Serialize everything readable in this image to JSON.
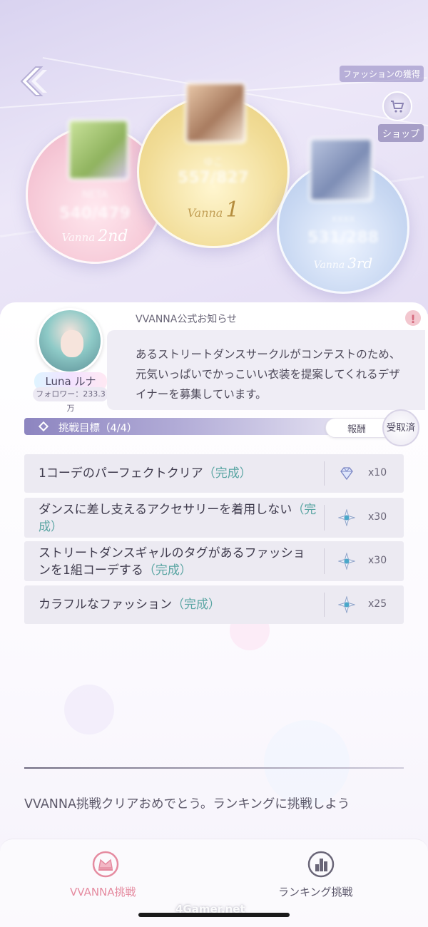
{
  "top": {
    "fashion_acquire_label": "ファッションの獲得",
    "shop_label": "ショップ",
    "podiums": [
      {
        "rank_label": "1",
        "name": "ゆこ",
        "score": "557/827"
      },
      {
        "rank_label": "2nd",
        "name": "NETA",
        "score": "540/479"
      },
      {
        "rank_label": "3rd",
        "name": "xxxx",
        "score": "531/288"
      }
    ],
    "podium_script": "Vanna"
  },
  "notice": {
    "title": "VVANNA公式お知らせ",
    "designer_name": "Luna ルナ",
    "followers": "フォロワー：233.3万",
    "body": "あるストリートダンスサークルがコンテストのため、元気いっぱいでかっこいい衣装を提案してくれるデザイナーを募集しています。"
  },
  "objectives": {
    "title": "挑戦目標（4/4）",
    "reward_label": "報酬",
    "claimed_label": "受取済",
    "tasks": [
      {
        "text": "1コーデのパーフェクトクリア",
        "status": "（完成）",
        "reward_icon": "diamond-icon",
        "qty": "x10"
      },
      {
        "text": "ダンスに差し支えるアクセサリーを着用しない",
        "status": "（完成）",
        "reward_icon": "star-gem-icon",
        "qty": "x30"
      },
      {
        "text": "ストリートダンスギャルのタグがあるファッションを1組コーデする",
        "status": "（完成）",
        "reward_icon": "star-gem-icon",
        "qty": "x30"
      },
      {
        "text": "カラフルなファッション",
        "status": "（完成）",
        "reward_icon": "star-gem-icon",
        "qty": "x25"
      }
    ]
  },
  "congrats": "VVANNA挑戦クリアおめでとう。ランキングに挑戦しよう",
  "nav": {
    "left_label": "VVANNA挑戦",
    "right_label": "ランキング挑戦",
    "active_color": "#e58ba0",
    "inactive_color": "#6a6678"
  },
  "watermark": "4Gamer.net"
}
